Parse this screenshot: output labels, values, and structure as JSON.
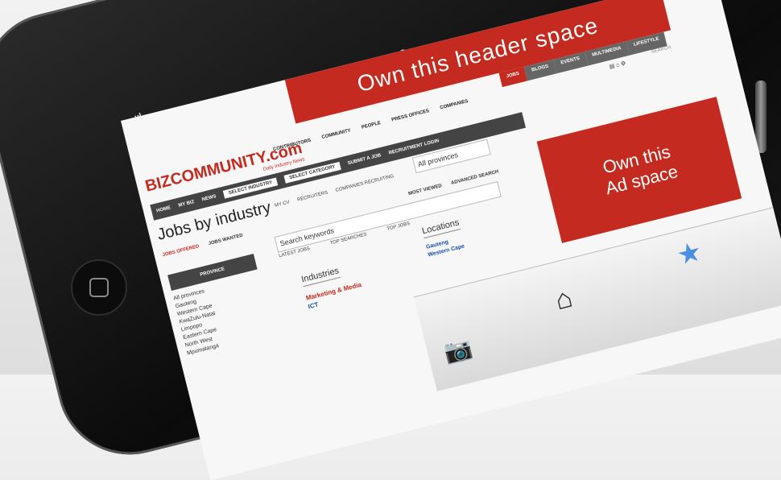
{
  "header_ad": "Own this header space",
  "side_ad": [
    "Own this",
    "Ad space"
  ],
  "top_nav": [
    "JOBS",
    "BLOGS",
    "EVENTS",
    "MULTIMEDIA",
    "LIFESTYLE"
  ],
  "search_top": "SEARCH",
  "logo": {
    "name": "BIZCOMMUNITY.com",
    "tagline": "Daily Industry News"
  },
  "main_nav": [
    "CONTRIBUTORS",
    "COMMUNITY",
    "PEOPLE",
    "PRESS OFFICES",
    "COMPANIES"
  ],
  "sec_nav": {
    "items": [
      "HOME",
      "MY BIZ",
      "NEWS"
    ],
    "industry": "SELECT INDUSTRY",
    "category": "SELECT CATEGORY",
    "submit": "SUBMIT A JOB",
    "recruit": "RECRUITMENT LOGIN"
  },
  "jobs_title": "Jobs by industry",
  "sub_nav": [
    "MY CV",
    "RECRUITERS",
    "COMPANIES RECRUITING"
  ],
  "province_select": "All provinces",
  "tabs": [
    "JOBS OFFERED",
    "JOBS WANTED"
  ],
  "tabs_right": [
    "MOST VIEWED",
    "ADVANCED SEARCH"
  ],
  "search_keywords": "Search keywords",
  "kw_tabs": [
    "LATEST JOBS",
    "TOP SEARCHES",
    "TOP JOBS"
  ],
  "province_heading": "PROVINCE",
  "provinces": [
    "All provinces",
    "Gauteng",
    "Western Cape",
    "KwaZulu-Natal",
    "Limpopo",
    "Eastern Cape",
    "North West",
    "Mpumalanga"
  ],
  "locations_heading": "Locations",
  "locations": [
    "Gauteng",
    "Western Cape"
  ],
  "industries_heading": "Industries",
  "industries": [
    "Marketing & Media",
    "ICT"
  ],
  "colors": {
    "brand_red": "#c42a1f",
    "link_blue": "#1a4fa8"
  }
}
